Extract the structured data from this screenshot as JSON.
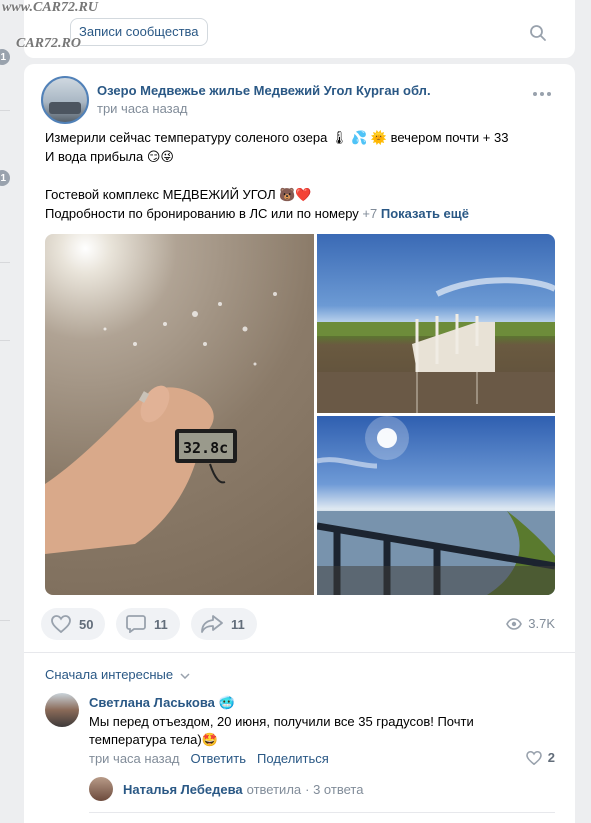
{
  "watermark": {
    "line1": "www.CAR72.RU",
    "line2": "CAR72.RO"
  },
  "left_rail": {
    "badge1": "1",
    "badge2": "1"
  },
  "header": {
    "tab_label": "Записи сообщества"
  },
  "post": {
    "group_name": "Озеро Медвежье жилье Медвежий Угол Курган обл.",
    "time": "три часа назад",
    "text_line1": "Измерили сейчас температуру соленого озера 🌡 💦 🌞 вечером почти + 33",
    "text_line2": "И вода прибыла 😏😜",
    "text_line3": "Гостевой комплекс МЕДВЕЖИЙ УГОЛ 🐻❤️",
    "text_line4_prefix": "Подробности по бронированию в ЛС или по номеру ",
    "text_line4_phone": "+7",
    "show_more": "Показать ещё",
    "thermometer_reading": "32.8c"
  },
  "actions": {
    "likes": "50",
    "comments": "11",
    "shares": "11",
    "views": "3.7K"
  },
  "comments": {
    "sort_label": "Сначала интересные",
    "author": "Светлана Ласькова 🥶",
    "text": "Мы перед отъездом, 20 июня, получили все 35 градусов! Почти температура тела)🤩",
    "time": "три часа назад",
    "reply_label": "Ответить",
    "share_label": "Поделиться",
    "likes": "2",
    "reply_author": "Наталья Лебедева",
    "reply_action": "ответила",
    "reply_count": "· 3 ответа"
  },
  "colors": {
    "link": "#2a5885",
    "muted": "#818c99",
    "bg": "#edeef0"
  }
}
